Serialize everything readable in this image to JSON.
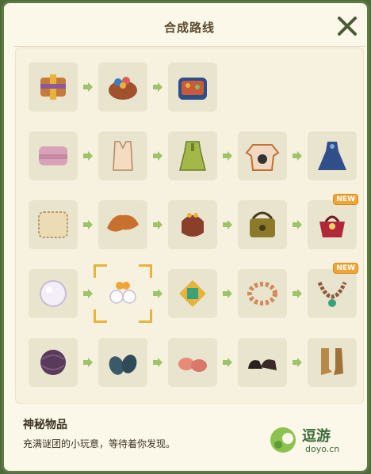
{
  "header": {
    "title": "合成路线"
  },
  "routes": [
    {
      "name": "route-bags",
      "items": [
        {
          "icon": "wrapped-fabric-icon"
        },
        {
          "icon": "craft-basket-icon"
        },
        {
          "icon": "sewing-box-icon"
        }
      ]
    },
    {
      "name": "route-clothes",
      "items": [
        {
          "icon": "folded-cloth-icon"
        },
        {
          "icon": "tank-top-icon"
        },
        {
          "icon": "green-dress-icon"
        },
        {
          "icon": "cat-sweater-icon"
        },
        {
          "icon": "blue-gown-icon"
        }
      ]
    },
    {
      "name": "route-purses",
      "items": [
        {
          "icon": "leather-patch-icon"
        },
        {
          "icon": "leather-hide-icon"
        },
        {
          "icon": "coin-purse-icon"
        },
        {
          "icon": "satchel-icon"
        },
        {
          "icon": "red-handbag-icon",
          "badge": "NEW"
        }
      ]
    },
    {
      "name": "route-jewelry",
      "items": [
        {
          "icon": "pearl-icon"
        },
        {
          "icon": "pearl-earrings-icon",
          "selected": true
        },
        {
          "icon": "gem-brooch-icon"
        },
        {
          "icon": "bead-bracelet-icon"
        },
        {
          "icon": "pearl-necklace-icon",
          "badge": "NEW"
        }
      ]
    },
    {
      "name": "route-shoes",
      "items": [
        {
          "icon": "yarn-ball-icon"
        },
        {
          "icon": "blue-slippers-icon"
        },
        {
          "icon": "pink-slippers-icon"
        },
        {
          "icon": "black-shoes-icon"
        },
        {
          "icon": "tan-boots-icon"
        }
      ]
    }
  ],
  "footer": {
    "title": "神秘物品",
    "desc": "充满谜团的小玩意，等待着你发现。"
  },
  "watermark": {
    "brand": "逗游",
    "domain": "doyo.cn"
  },
  "colors": {
    "accent": "#5c7a42",
    "arrow": "#9ec36a",
    "cell": "#e9e4cd",
    "badge": "#f0a637"
  }
}
